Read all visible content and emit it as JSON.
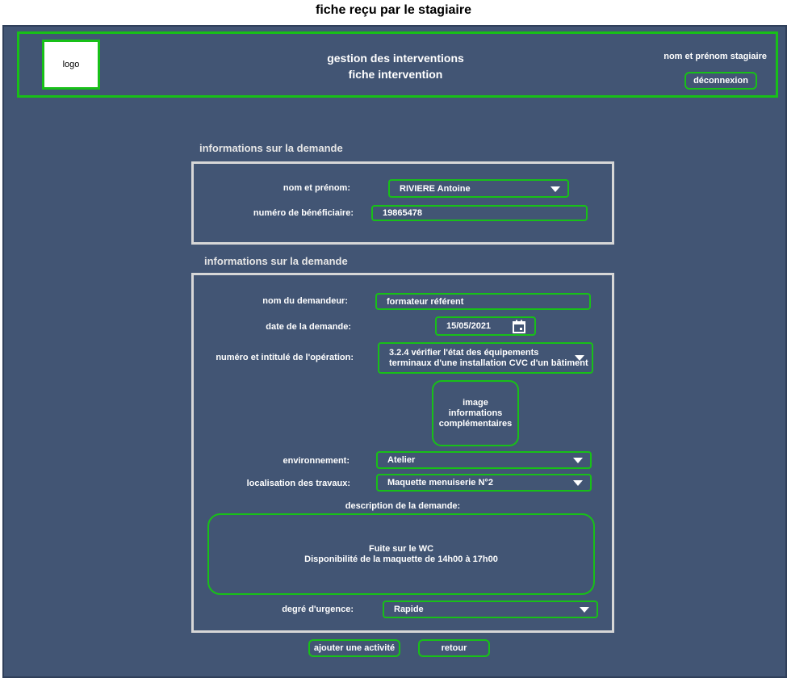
{
  "page_title": "fiche reçu par le stagiaire",
  "header": {
    "logo_text": "logo",
    "app_title_line1": "gestion des interventions",
    "app_title_line2": "fiche intervention",
    "user_label": "nom et prénom stagiaire",
    "logout_label": "déconnexion"
  },
  "section1": {
    "title": "informations sur la demande",
    "name_label": "nom et prénom:",
    "name_value": "RIVIERE Antoine",
    "beneficiary_label": "numéro de bénéficiaire:",
    "beneficiary_value": "19865478"
  },
  "section2": {
    "title": "informations sur la demande",
    "requester_label": "nom du demandeur:",
    "requester_value": "formateur référent",
    "date_label": "date de la demande:",
    "date_value": "15/05/2021",
    "operation_label": "numéro et intitulé de l'opération:",
    "operation_line1": "3.2.4 vérifier l'état des équipements",
    "operation_line2": "terminaux d'une installation CVC d'un bâtiment",
    "image_line1": "image",
    "image_line2": "informations",
    "image_line3": "complémentaires",
    "environment_label": "environnement:",
    "environment_value": "Atelier",
    "location_label": "localisation des travaux:",
    "location_value": "Maquette menuiserie N°2",
    "description_label": "description de la demande:",
    "description_line1": "Fuite sur le WC",
    "description_line2": "Disponibilité de la maquette de 14h00 à 17h00",
    "urgency_label": "degré d'urgence:",
    "urgency_value": "Rapide"
  },
  "actions": {
    "add_activity_label": "ajouter une activité",
    "back_label": "retour"
  },
  "icons": {
    "dropdown": "chevron-down-icon",
    "date_picker": "calendar-icon"
  },
  "colors": {
    "background": "#425574",
    "accent_border": "#18c018",
    "panel_border": "#d7d7d7"
  }
}
